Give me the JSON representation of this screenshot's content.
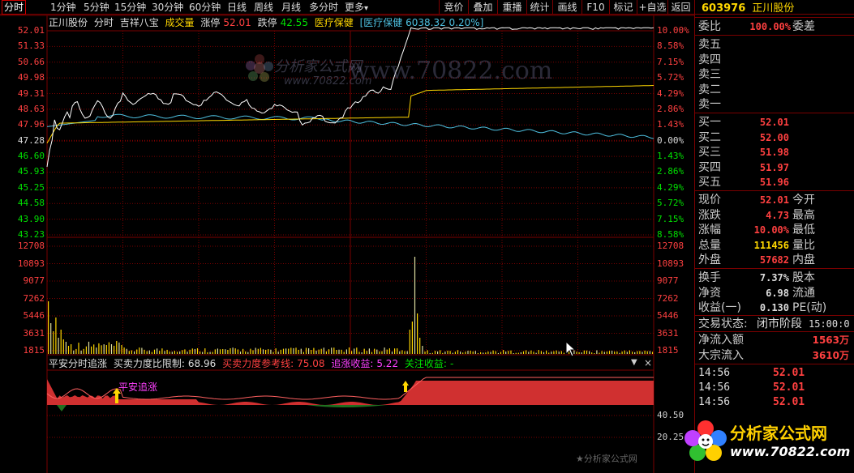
{
  "toolbar": {
    "tabs": [
      "分时",
      "1分钟",
      "5分钟",
      "15分钟",
      "30分钟",
      "60分钟",
      "日线",
      "周线",
      "月线",
      "多分时",
      "更多"
    ],
    "tab_more_arrow": "▾",
    "buttons": [
      "竞价",
      "叠加",
      "重播",
      "统计",
      "画线",
      "F10",
      "标记",
      "+自选",
      "返回"
    ]
  },
  "chart_header": {
    "stock": "正川股份",
    "mode": "分时",
    "brand": "吉祥八宝",
    "volume_label": "成交量",
    "limit_up_label": "涨停",
    "limit_up_value": "52.01",
    "limit_down_label": "跌停",
    "limit_down_value": "42.55",
    "sector": "医疗保健",
    "sector_index": "[医疗保健 6038.32 0.20%]"
  },
  "indicator_header": {
    "name": "平安分时追涨",
    "ratio_label": "买卖力度比限制:",
    "ratio_value": "68.96",
    "ref_label": "买卖力度参考线:",
    "ref_value": "75.08",
    "gain_label": "追涨收益:",
    "gain_value": "5.22",
    "watch_label": "关注收益:",
    "watch_value": "-",
    "marker_text": "平安追涨"
  },
  "price_axis": {
    "left": [
      "52.01",
      "51.33",
      "50.66",
      "49.98",
      "49.31",
      "48.63",
      "47.96",
      "47.28",
      "46.60",
      "45.93",
      "45.25",
      "44.58",
      "43.90",
      "43.23"
    ],
    "right": [
      "10.00%",
      "8.58%",
      "7.15%",
      "5.72%",
      "4.29%",
      "2.86%",
      "1.43%",
      "0.00%",
      "1.43%",
      "2.86%",
      "4.29%",
      "5.72%",
      "7.15%",
      "8.58%"
    ]
  },
  "volume_axis": {
    "left": [
      "12708",
      "10893",
      "9077",
      "7262",
      "5446",
      "3631",
      "1815"
    ],
    "right": [
      "12708",
      "10893",
      "9077",
      "7262",
      "5446",
      "3631",
      "1815"
    ]
  },
  "indicator_axis": [
    "40.50",
    "20.25"
  ],
  "quote": {
    "code": "603976",
    "name": "正川股份",
    "weibi_label": "委比",
    "weibi_value": "100.00%",
    "weicha_label": "委差",
    "asks": [
      "卖五",
      "卖四",
      "卖三",
      "卖二",
      "卖一"
    ],
    "bids": [
      {
        "label": "买一",
        "price": "52.01"
      },
      {
        "label": "买二",
        "price": "52.00"
      },
      {
        "label": "买三",
        "price": "51.98"
      },
      {
        "label": "买四",
        "price": "51.97"
      },
      {
        "label": "买五",
        "price": "51.96"
      }
    ],
    "stats": [
      {
        "l1": "现价",
        "v": "52.01",
        "l2": "今开",
        "color": "#ff4040"
      },
      {
        "l1": "涨跌",
        "v": "4.73",
        "l2": "最高",
        "color": "#ff4040"
      },
      {
        "l1": "涨幅",
        "v": "10.00%",
        "l2": "最低",
        "color": "#ff4040"
      },
      {
        "l1": "总量",
        "v": "111456",
        "l2": "量比",
        "color": "#ffd700"
      },
      {
        "l1": "外盘",
        "v": "57682",
        "l2": "内盘",
        "color": "#ff4040"
      }
    ],
    "stats2": [
      {
        "l1": "换手",
        "v": "7.37%",
        "l2": "股本",
        "color": "#ddd"
      },
      {
        "l1": "净资",
        "v": "6.98",
        "l2": "流通",
        "color": "#ddd"
      },
      {
        "l1": "收益(一)",
        "v": "0.130",
        "l2": "PE(动)",
        "color": "#ddd"
      }
    ],
    "status_label": "交易状态:",
    "status_value": "闭市阶段",
    "status_time": "15:00:0",
    "net_inflow_label": "净流入额",
    "net_inflow_value": "1563万",
    "big_inflow_label": "大宗流入",
    "big_inflow_value": "3610万",
    "trades": [
      {
        "time": "14:56",
        "price": "52.01"
      },
      {
        "time": "14:56",
        "price": "52.01"
      },
      {
        "time": "14:56",
        "price": "52.01"
      }
    ]
  },
  "watermark": {
    "text": "www.70822.com",
    "small": "分析家公式网",
    "small_url": "www.70822.com",
    "logo_name": "分析家公式网",
    "logo_url": "www.70822.com",
    "footer": "★分析家公式网"
  },
  "colors": {
    "up": "#ff4040",
    "down": "#00e000",
    "price_line": "#ffffff",
    "avg_line": "#ffd700",
    "index_line": "#4ec0e0",
    "grid": "#7a0000"
  }
}
